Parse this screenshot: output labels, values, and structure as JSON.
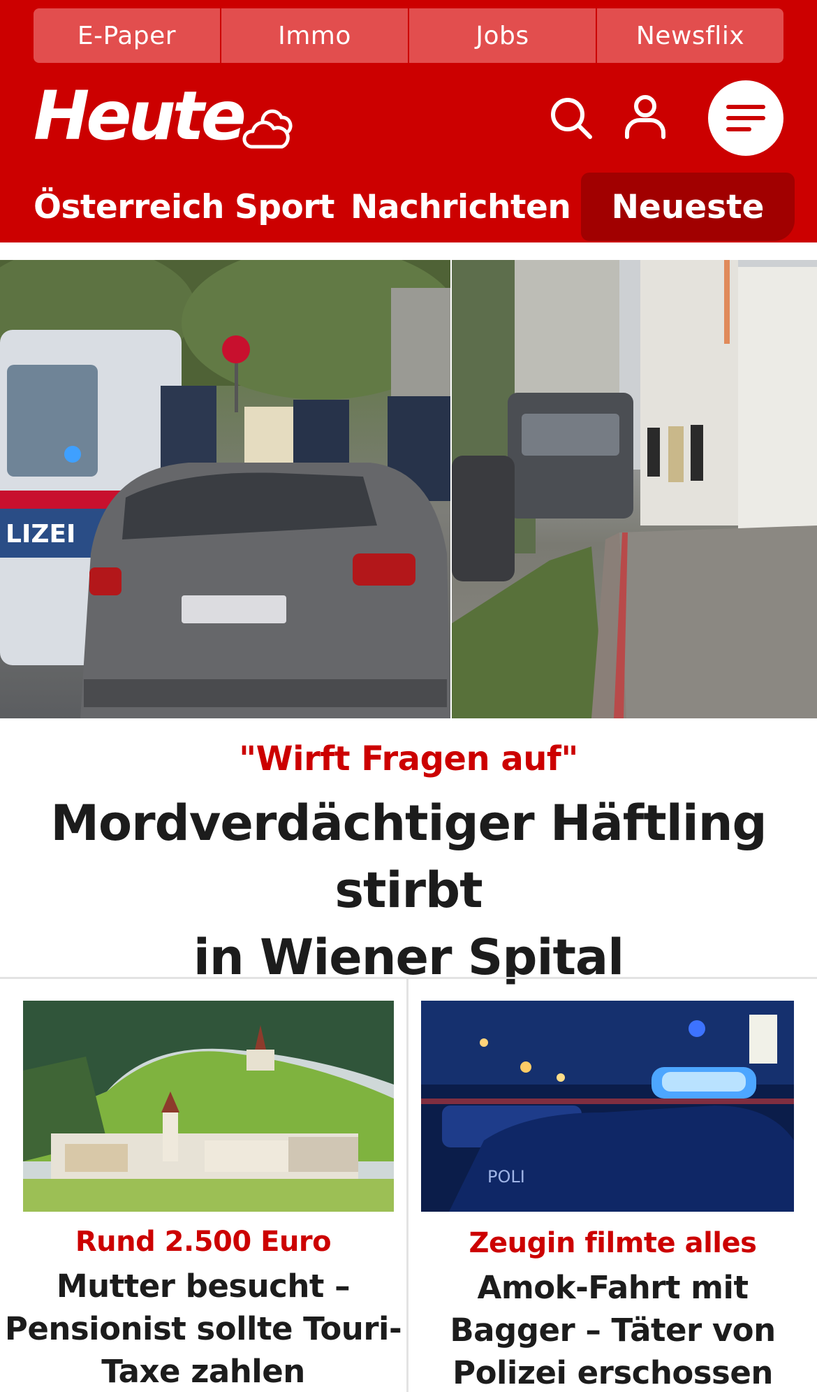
{
  "top_links": [
    "E-Paper",
    "Immo",
    "Jobs",
    "Newsflix"
  ],
  "brand": {
    "logo": "Heute"
  },
  "icons": {
    "weather": "cloud-weather-icon",
    "search": "search-icon",
    "account": "user-icon",
    "menu": "hamburger-menu-icon"
  },
  "nav": {
    "items": [
      "Österreich",
      "Sport",
      "Nachrichten"
    ],
    "active": "Neueste"
  },
  "hero": {
    "image_description_alt": "",
    "kicker": "\"Wirft Fragen auf\"",
    "headline_line1": "Mordverdächtiger Häftling stirbt",
    "headline_line2": "in Wiener Spital"
  },
  "teasers": [
    {
      "kicker": "Rund 2.500 Euro",
      "title_lines": [
        "Mutter besucht –",
        "Pensionist sollte Touri-",
        "Taxe zahlen"
      ]
    },
    {
      "kicker": "Zeugin filmte alles",
      "title_lines": [
        "Amok-Fahrt mit",
        "Bagger – Täter von",
        "Polizei erschossen"
      ]
    }
  ],
  "colors": {
    "brand_red": "#cc0000",
    "nav_active": "#a10000",
    "top_link_bg": "#e24e4e",
    "headline": "#1c1c1c"
  }
}
